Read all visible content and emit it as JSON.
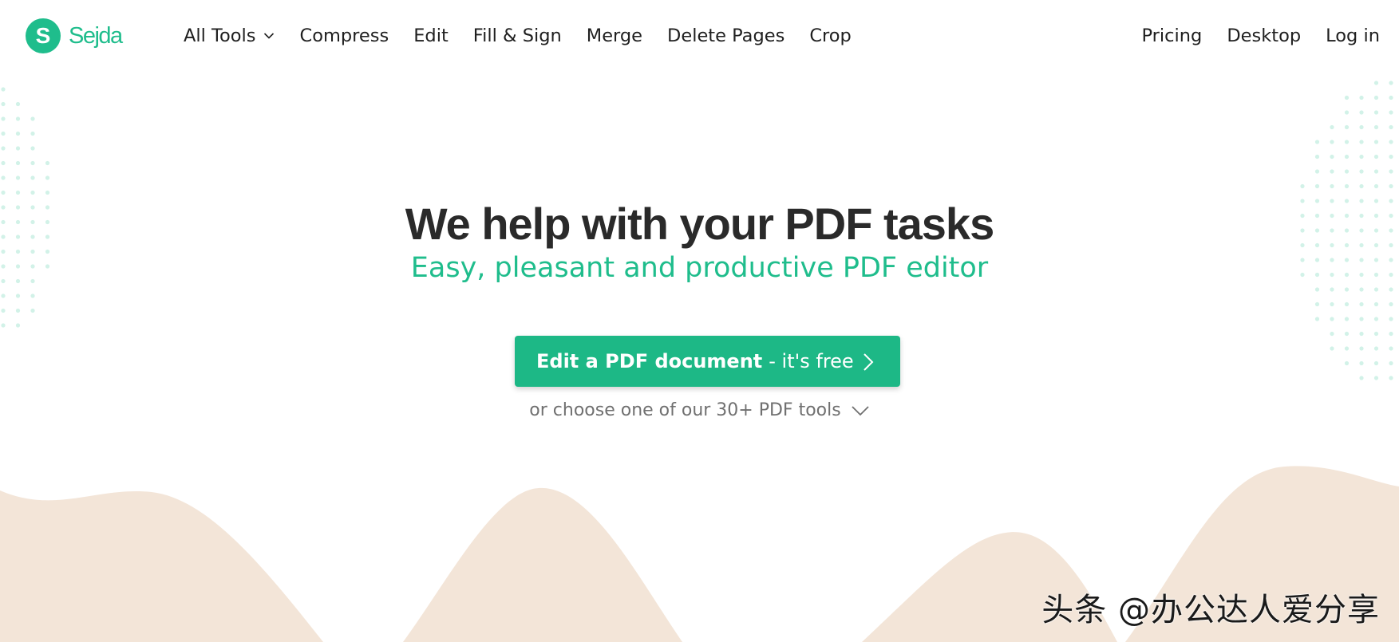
{
  "brand": {
    "name": "Sejda",
    "logo_letter": "S",
    "color": "#1fbd8c"
  },
  "nav": {
    "left_items": [
      "All Tools",
      "Compress",
      "Edit",
      "Fill & Sign",
      "Merge",
      "Delete Pages",
      "Crop"
    ],
    "right_items": [
      "Pricing",
      "Desktop",
      "Log in"
    ]
  },
  "hero": {
    "title": "We help with your PDF tasks",
    "subtitle": "Easy, pleasant and productive PDF editor",
    "cta_strong": "Edit a PDF document",
    "cta_rest": "- it's free",
    "tools_link": "or choose one of our 30+ PDF tools"
  },
  "watermark": "头条 @办公达人爱分享",
  "colors": {
    "accent": "#1fbd8c",
    "button": "#1db886",
    "wave": "#f3e5d8",
    "dots": "#d2f2e8"
  },
  "icons": {
    "logo": "sejda-logo-icon",
    "all_tools_dropdown": "chevron-down-icon",
    "cta_arrow": "chevron-right-icon",
    "tools_dropdown": "chevron-down-icon"
  }
}
